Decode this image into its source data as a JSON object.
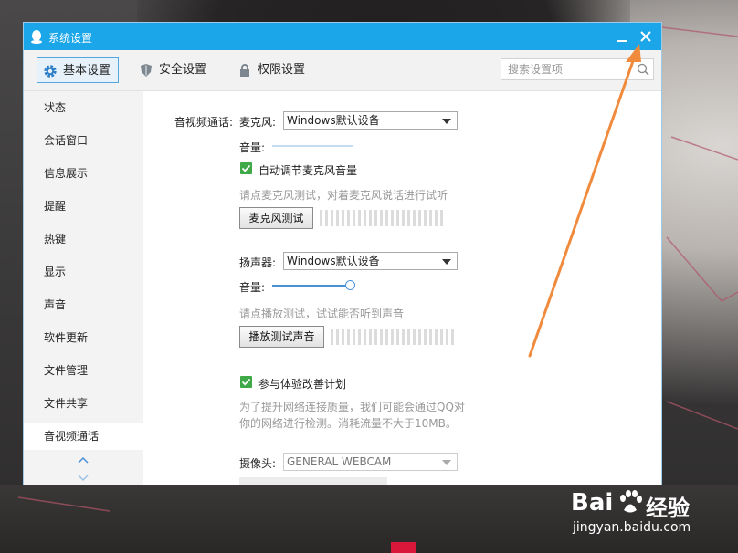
{
  "window": {
    "title": "系统设置"
  },
  "toolbar": {
    "tabs": [
      {
        "label": "基本设置",
        "active": true
      },
      {
        "label": "安全设置",
        "active": false
      },
      {
        "label": "权限设置",
        "active": false
      }
    ],
    "search_placeholder": "搜索设置项"
  },
  "sidebar": {
    "items": [
      {
        "label": "状态"
      },
      {
        "label": "会话窗口"
      },
      {
        "label": "信息展示"
      },
      {
        "label": "提醒"
      },
      {
        "label": "热键"
      },
      {
        "label": "显示"
      },
      {
        "label": "声音"
      },
      {
        "label": "软件更新"
      },
      {
        "label": "文件管理"
      },
      {
        "label": "文件共享"
      },
      {
        "label": "音视频通话",
        "active": true
      }
    ]
  },
  "content": {
    "section_label": "音视频通话:",
    "microphone": {
      "label": "麦克风:",
      "device": "Windows默认设备",
      "volume_label": "音量:",
      "volume_level": 0,
      "auto_adjust_label": "自动调节麦克风音量",
      "auto_adjust_checked": true,
      "hint": "请点麦克风测试，对着麦克风说话进行试听",
      "test_button": "麦克风测试"
    },
    "speaker": {
      "label": "扬声器:",
      "device": "Windows默认设备",
      "volume_label": "音量:",
      "volume_level": 1,
      "hint": "请点播放测试，试试能否听到声音",
      "test_button": "播放测试声音"
    },
    "experience": {
      "label": "参与体验改善计划",
      "checked": true,
      "description_line1": "为了提升网络连接质量，我们可能会通过QQ对",
      "description_line2": "你的网络进行检测。消耗流量不大于10MB。"
    },
    "camera": {
      "label": "摄像头:",
      "device": "GENERAL WEBCAM"
    }
  },
  "watermark": {
    "brand_left": "Bai",
    "brand_right": "经验",
    "url": "jingyan.baidu.com"
  },
  "colors": {
    "titlebar": "#1aa6e8",
    "check_green": "#3fa948",
    "annotation_arrow": "#f08a3c",
    "slider": "#4a90d6"
  }
}
